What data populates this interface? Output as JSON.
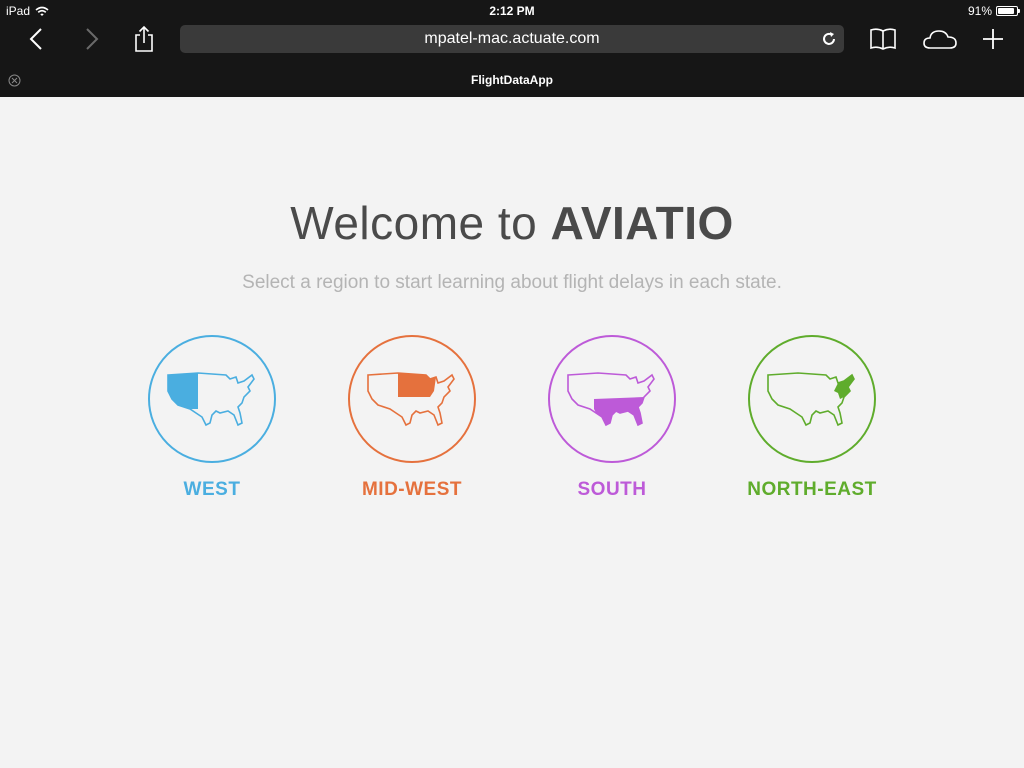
{
  "status": {
    "device": "iPad",
    "time": "2:12 PM",
    "battery": "91%",
    "battery_level": 0.91
  },
  "browser": {
    "url": "mpatel-mac.actuate.com",
    "tab_title": "FlightDataApp"
  },
  "main": {
    "welcome_prefix": "Welcome to ",
    "welcome_brand": "AVIATIO",
    "subtitle": "Select a region to start learning about flight delays in each state."
  },
  "regions": [
    {
      "label": "WEST",
      "color": "#4aaee0",
      "icon": "us-map-west-icon"
    },
    {
      "label": "MID-WEST",
      "color": "#e5713d",
      "icon": "us-map-midwest-icon"
    },
    {
      "label": "SOUTH",
      "color": "#bd5ad8",
      "icon": "us-map-south-icon"
    },
    {
      "label": "NORTH-EAST",
      "color": "#5fac2c",
      "icon": "us-map-northeast-icon"
    }
  ]
}
